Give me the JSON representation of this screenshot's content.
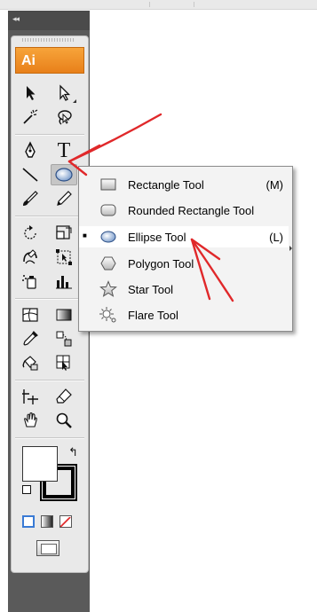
{
  "panel": {
    "collapse_glyph": "◂◂",
    "logo_text": "Ai"
  },
  "tools": [
    {
      "name": "selection-tool",
      "icon": "arrow-icon"
    },
    {
      "name": "direct-selection-tool",
      "icon": "hollow-arrow-icon"
    },
    {
      "name": "magic-wand-tool",
      "icon": "magic-wand-icon"
    },
    {
      "name": "lasso-tool",
      "icon": "lasso-icon"
    },
    {
      "name": "pen-tool",
      "icon": "pen-nib-icon"
    },
    {
      "name": "type-tool",
      "icon": "type-icon",
      "glyph": "T"
    },
    {
      "name": "line-segment-tool",
      "icon": "line-icon"
    },
    {
      "name": "ellipse-tool",
      "icon": "ellipse-icon",
      "active": true
    },
    {
      "name": "paintbrush-tool",
      "icon": "brush-icon"
    },
    {
      "name": "pencil-tool",
      "icon": "pencil-icon"
    },
    {
      "name": "rotate-tool",
      "icon": "rotate-icon"
    },
    {
      "name": "scale-tool",
      "icon": "scale-icon"
    },
    {
      "name": "warp-tool",
      "icon": "warp-icon"
    },
    {
      "name": "free-transform-tool",
      "icon": "free-transform-icon"
    },
    {
      "name": "symbol-sprayer-tool",
      "icon": "symbol-sprayer-icon"
    },
    {
      "name": "column-graph-tool",
      "icon": "bar-graph-icon"
    },
    {
      "name": "mesh-tool",
      "icon": "mesh-icon"
    },
    {
      "name": "gradient-tool",
      "icon": "gradient-icon"
    },
    {
      "name": "eyedropper-tool",
      "icon": "eyedropper-icon"
    },
    {
      "name": "blend-tool",
      "icon": "blend-icon"
    },
    {
      "name": "live-paint-bucket-tool",
      "icon": "paint-bucket-icon"
    },
    {
      "name": "live-paint-selection-tool",
      "icon": "live-paint-selection-icon"
    },
    {
      "name": "slice-tool",
      "icon": "slice-icon"
    },
    {
      "name": "eraser-tool",
      "icon": "eraser-icon"
    },
    {
      "name": "hand-tool",
      "icon": "hand-icon"
    },
    {
      "name": "zoom-tool",
      "icon": "zoom-icon"
    }
  ],
  "colors": {
    "fill": "#ffffff",
    "stroke": "#000000",
    "modes": [
      "color-mode-icon",
      "gradient-mode-icon",
      "none-mode-icon"
    ]
  },
  "screen_mode": "screen-mode-icon",
  "flyout": {
    "items": [
      {
        "label": "Rectangle Tool",
        "shortcut": "(M)",
        "icon": "rectangle-icon",
        "selected": false
      },
      {
        "label": "Rounded Rectangle Tool",
        "shortcut": "",
        "icon": "rounded-rectangle-icon",
        "selected": false
      },
      {
        "label": "Ellipse Tool",
        "shortcut": "(L)",
        "icon": "ellipse-icon",
        "selected": true,
        "check": "■"
      },
      {
        "label": "Polygon Tool",
        "shortcut": "",
        "icon": "polygon-icon",
        "selected": false
      },
      {
        "label": "Star Tool",
        "shortcut": "",
        "icon": "star-icon",
        "selected": false
      },
      {
        "label": "Flare Tool",
        "shortcut": "",
        "icon": "flare-icon",
        "selected": false
      }
    ]
  },
  "annotation_color": "#e0282a"
}
